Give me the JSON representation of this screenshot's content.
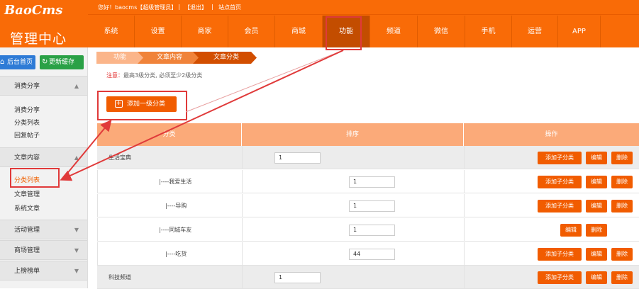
{
  "brand": {
    "logo_en": "BaoCms",
    "logo_cn": "管理中心"
  },
  "userbar": {
    "greeting": "您好！baocms【超级管理员】",
    "sep1": "|",
    "logout": "【退出】",
    "sep2": "|",
    "site_home": "站点首页"
  },
  "nav": [
    {
      "label": "系统"
    },
    {
      "label": "设置"
    },
    {
      "label": "商家"
    },
    {
      "label": "会员"
    },
    {
      "label": "商城"
    },
    {
      "label": "功能",
      "active": true
    },
    {
      "label": "频道"
    },
    {
      "label": "微信"
    },
    {
      "label": "手机"
    },
    {
      "label": "运营"
    },
    {
      "label": "APP"
    }
  ],
  "sidebar": {
    "home_label": "后台首页",
    "cache_label": "更新缓存",
    "groups": [
      {
        "title": "消费分享",
        "expanded": true,
        "items": [
          "消费分享",
          "分类列表",
          "回复帖子"
        ]
      },
      {
        "title": "文章内容",
        "expanded": true,
        "items": [
          "分类列表",
          "文章管理",
          "系统文章"
        ],
        "active_item": "分类列表"
      },
      {
        "title": "活动管理",
        "expanded": false
      },
      {
        "title": "商场管理",
        "expanded": false
      },
      {
        "title": "上榜榜单",
        "expanded": false
      }
    ]
  },
  "breadcrumb": [
    "功能",
    "文章内容",
    "文章分类"
  ],
  "notice": {
    "label": "注意：",
    "text": "最高3级分类, 必须至少2级分类"
  },
  "add_top_label": "添加一级分类",
  "table": {
    "headers": [
      "分类",
      "排序",
      "操作"
    ],
    "rows": [
      {
        "name": "生活宝典",
        "sort": "1",
        "level": 1,
        "actions": [
          "添加子分类",
          "编辑",
          "删除"
        ]
      },
      {
        "name": "|----我爱生活",
        "sort": "1",
        "level": 2,
        "actions": [
          "添加子分类",
          "编辑",
          "删除"
        ]
      },
      {
        "name": "|----导购",
        "sort": "1",
        "level": 2,
        "actions": [
          "添加子分类",
          "编辑",
          "删除"
        ]
      },
      {
        "name": "|----同城车友",
        "sort": "1",
        "level": 2,
        "actions": [
          "编辑",
          "删除"
        ]
      },
      {
        "name": "|----吃货",
        "sort": "44",
        "level": 2,
        "actions": [
          "添加子分类",
          "编辑",
          "删除"
        ]
      },
      {
        "name": "科技频道",
        "sort": "1",
        "level": 1,
        "actions": [
          "添加子分类",
          "编辑",
          "删除"
        ]
      }
    ]
  },
  "colors": {
    "brand": "#f96b07",
    "button": "#f15c00",
    "header": "#fbaa79",
    "highlight": "#e03a3a"
  }
}
